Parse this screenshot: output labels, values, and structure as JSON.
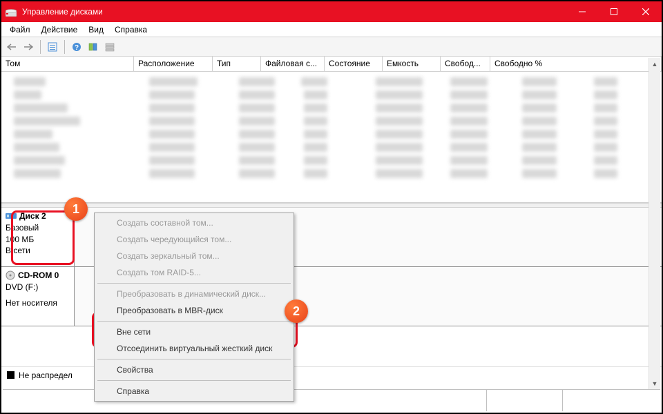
{
  "window": {
    "title": "Управление дисками"
  },
  "menu": {
    "file": "Файл",
    "action": "Действие",
    "view": "Вид",
    "help": "Справка"
  },
  "columns": {
    "c0": "Том",
    "c1": "Расположение",
    "c2": "Тип",
    "c3": "Файловая с...",
    "c4": "Состояние",
    "c5": "Емкость",
    "c6": "Свобод...",
    "c7": "Свободно %"
  },
  "disk2": {
    "name": "Диск 2",
    "type": "Базовый",
    "size": "100 МБ",
    "status": "В сети"
  },
  "cdrom": {
    "name": "CD-ROM 0",
    "drive": "DVD (F:)",
    "status": "Нет носителя"
  },
  "legend": {
    "unalloc": "Не распредел"
  },
  "ctx": {
    "spanned": "Создать составной том...",
    "striped": "Создать чередующийся том...",
    "mirror": "Создать зеркальный том...",
    "raid5": "Создать том RAID-5...",
    "todyn": "Преобразовать в динамический диск...",
    "tombr": "Преобразовать в MBR-диск",
    "offline": "Вне сети",
    "detach": "Отсоединить виртуальный жесткий диск",
    "props": "Свойства",
    "help": "Справка"
  },
  "badges": {
    "one": "1",
    "two": "2"
  }
}
